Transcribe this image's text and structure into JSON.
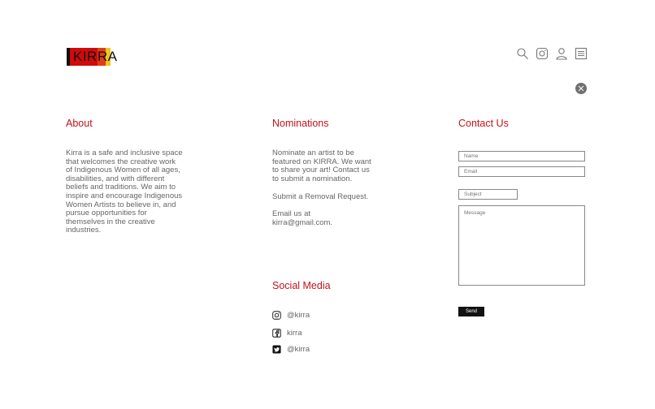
{
  "header": {
    "logo_text": "KIRRA",
    "icons": [
      "search-icon",
      "instagram-icon",
      "user-icon",
      "menu-icon"
    ]
  },
  "about": {
    "title": "About",
    "text": "Kirra is a safe and inclusive space\nthat welcomes the creative work\nof Indigenous Women of all ages,\ndisabilities, and with different\nbeliefs and traditions. We aim to\ninspire and encourage Indigenous\nWomen Artists to believe in, and\npursue opportunities for\nthemselves in the creative\nindustries."
  },
  "nominations": {
    "title": "Nominations",
    "text": "Nominate an artist to be\nfeatured on KIRRA. We want\nto share your art! Contact us\nto submit a nomination.",
    "removal": "Submit a Removal Request.",
    "email": "Email us at\nkirra@gmail.com."
  },
  "social": {
    "title": "Social Media",
    "items": [
      {
        "icon": "instagram-icon",
        "label": "@kirra"
      },
      {
        "icon": "facebook-icon",
        "label": "kirra"
      },
      {
        "icon": "twitter-icon",
        "label": "@kirra"
      }
    ]
  },
  "contact": {
    "title": "Contact Us",
    "name_placeholder": "Name",
    "email_placeholder": "Email",
    "subject_placeholder": "Subject",
    "message_placeholder": "Message",
    "send_label": "Send"
  },
  "colors": {
    "accent": "#c0141b",
    "button_bg": "#111111"
  }
}
